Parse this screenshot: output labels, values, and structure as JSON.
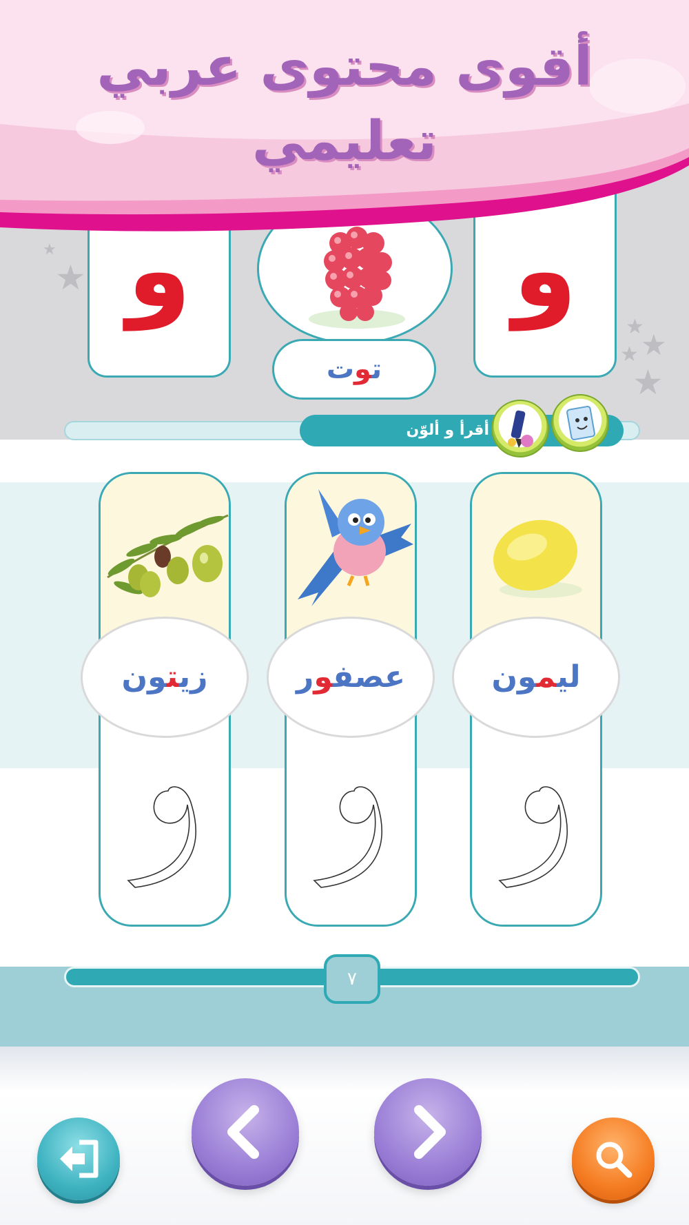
{
  "banner": {
    "line1": "أقوى محتوى عربي",
    "line2": "تعليمي"
  },
  "top_section": {
    "left_letter": "و",
    "right_letter": "و",
    "center_word_prefix": "ت",
    "center_word_highlight": "و",
    "center_word_suffix": "ت",
    "center_image": "mulberry-image"
  },
  "section_header": {
    "title": "أقرأ و ألوّن",
    "badges": [
      "book-icon",
      "pen-icon"
    ]
  },
  "columns": [
    {
      "image": "lemon-image",
      "word_before": "لي",
      "word_highlight": "م",
      "word_after": "ون",
      "trace_letter": "و"
    },
    {
      "image": "bird-image",
      "word_before": "عصف",
      "word_highlight": "و",
      "word_after": "ر",
      "trace_letter": "و"
    },
    {
      "image": "olives-image",
      "word_before": "زي",
      "word_highlight": "ت",
      "word_after": "ون",
      "trace_letter": "و"
    }
  ],
  "page": {
    "number": "٧"
  },
  "nav": {
    "exit": "exit-icon",
    "previous": "chevron-left-icon",
    "next": "chevron-right-icon",
    "search": "search-icon"
  },
  "colors": {
    "teal": "#2fa9b4",
    "letter_red": "#e01b2a",
    "word_blue": "#4c75c4",
    "banner_pink": "#f7c9df",
    "banner_magenta": "#e0118c",
    "title_purple": "#a264b8",
    "button_purple": "#9a7ed6",
    "button_orange": "#f57c22"
  }
}
